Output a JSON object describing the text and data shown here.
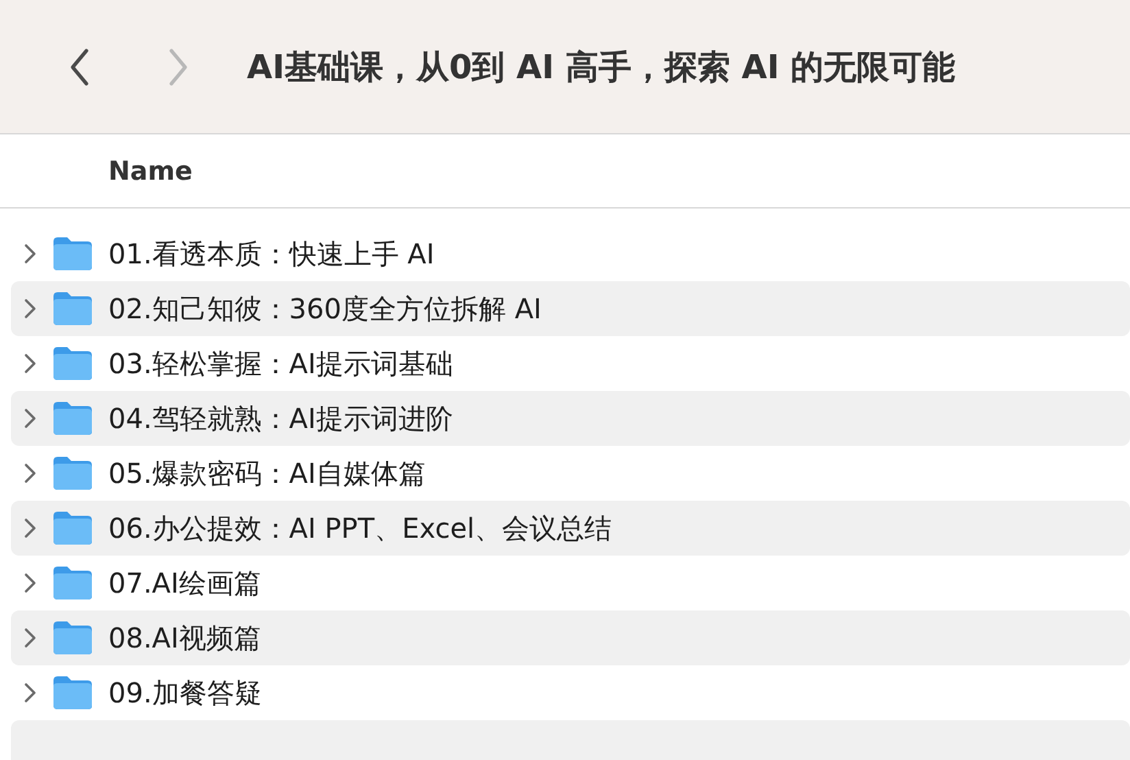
{
  "toolbar": {
    "back": {
      "disabled": false
    },
    "forward": {
      "disabled": true
    },
    "title": "AI基础课，从0到 AI 高手，探索 AI 的无限可能"
  },
  "list": {
    "columns": [
      "Name"
    ],
    "rows": [
      {
        "name": "01.看透本质：快速上手 AI",
        "expanded": false
      },
      {
        "name": "02.知己知彼：360度全方位拆解 AI",
        "expanded": false
      },
      {
        "name": "03.轻松掌握：AI提示词基础",
        "expanded": false
      },
      {
        "name": "04.驾轻就熟：AI提示词进阶",
        "expanded": false
      },
      {
        "name": "05.爆款密码：AI自媒体篇",
        "expanded": false
      },
      {
        "name": "06.办公提效：AI PPT、Excel、会议总结",
        "expanded": false
      },
      {
        "name": "07.AI绘画篇",
        "expanded": false
      },
      {
        "name": "08.AI视频篇",
        "expanded": false
      },
      {
        "name": "09.加餐答疑",
        "expanded": false
      }
    ]
  }
}
